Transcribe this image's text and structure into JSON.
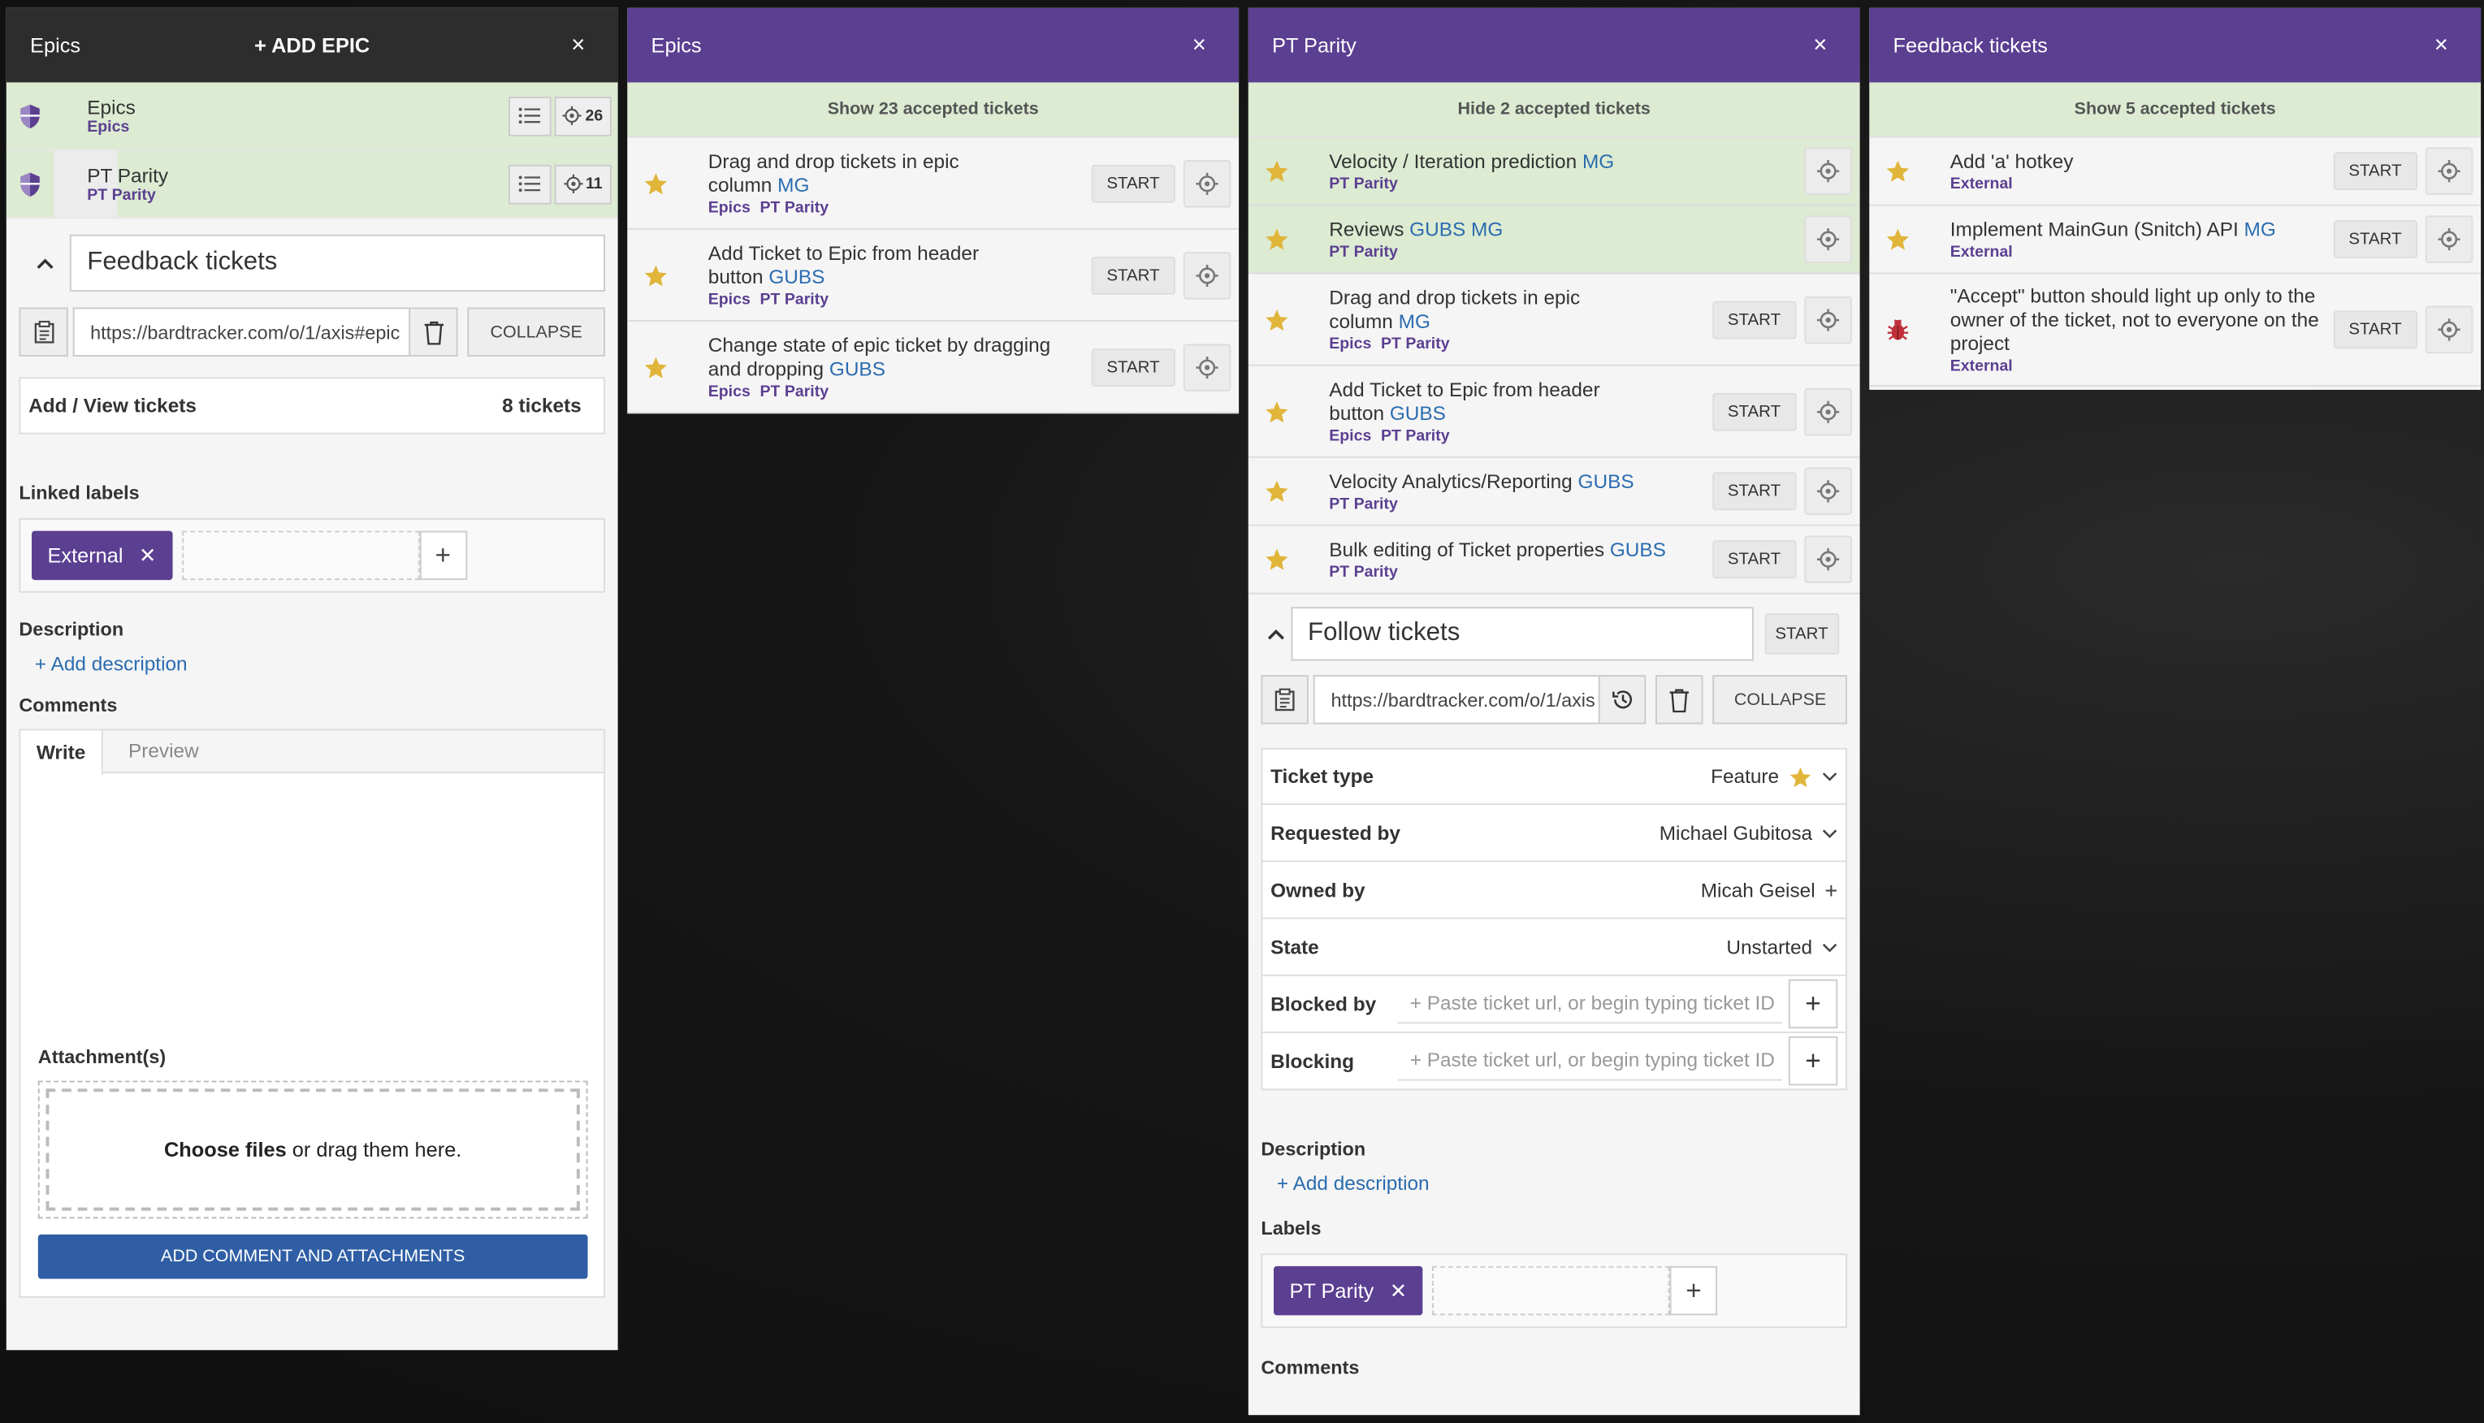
{
  "panel1": {
    "title": "Epics",
    "add_label": "+ ADD EPIC",
    "close": "×",
    "epics": [
      {
        "name": "Epics",
        "label": "Epics",
        "count": "26"
      },
      {
        "name": "PT Parity",
        "label": "PT Parity",
        "count": "11"
      }
    ],
    "editor": {
      "title_value": "Feedback tickets",
      "url": "https://bardtracker.com/o/1/axis#epic",
      "collapse": "COLLAPSE",
      "add_view": "Add / View tickets",
      "ticket_count": "8 tickets",
      "linked_labels": "Linked labels",
      "chip": "External",
      "description": "Description",
      "add_description": "+ Add description",
      "comments": "Comments",
      "tab_write": "Write",
      "tab_preview": "Preview",
      "attachments": "Attachment(s)",
      "choose_files": "Choose files",
      "drag_text": " or drag them here.",
      "submit": "ADD COMMENT AND ATTACHMENTS"
    }
  },
  "panel2": {
    "title": "Epics",
    "close": "×",
    "accepted": "Show 23 accepted tickets",
    "tickets": [
      {
        "line1": "Drag and drop tickets in epic",
        "line2": "column ",
        "owner": "MG",
        "labels": [
          "Epics",
          "PT Parity"
        ],
        "start": "START"
      },
      {
        "line1": "Add Ticket to Epic from header",
        "line2": "button ",
        "owner": "GUBS",
        "labels": [
          "Epics",
          "PT Parity"
        ],
        "start": "START"
      },
      {
        "line1": "Change state of epic ticket by dragging",
        "line2": "and dropping ",
        "owner": "GUBS",
        "labels": [
          "Epics",
          "PT Parity"
        ],
        "start": "START"
      }
    ]
  },
  "panel3": {
    "title": "PT Parity",
    "close": "×",
    "accepted": "Hide 2 accepted tickets",
    "accepted_tickets": [
      {
        "title": "Velocity / Iteration prediction ",
        "owner": "MG",
        "label": "PT Parity"
      },
      {
        "title": "Reviews ",
        "owner": "GUBS MG",
        "label": "PT Parity"
      }
    ],
    "tickets": [
      {
        "line1": "Drag and drop tickets in epic",
        "line2": "column ",
        "owner": "MG",
        "labels": [
          "Epics",
          "PT Parity"
        ],
        "start": "START"
      },
      {
        "line1": "Add Ticket to Epic from header",
        "line2": "button ",
        "owner": "GUBS",
        "labels": [
          "Epics",
          "PT Parity"
        ],
        "start": "START"
      },
      {
        "line1": "Velocity Analytics/Reporting ",
        "line2": "",
        "owner": "GUBS",
        "labels": [
          "PT Parity"
        ],
        "start": "START"
      },
      {
        "line1": "Bulk editing of Ticket properties ",
        "line2": "",
        "owner": "GUBS",
        "labels": [
          "PT Parity"
        ],
        "start": "START"
      }
    ],
    "detail": {
      "title_value": "Follow tickets",
      "start": "START",
      "url": "https://bardtracker.com/o/1/axis",
      "collapse": "COLLAPSE",
      "fields": {
        "ticket_type": {
          "label": "Ticket type",
          "value": "Feature"
        },
        "requested_by": {
          "label": "Requested by",
          "value": "Michael Gubitosa"
        },
        "owned_by": {
          "label": "Owned by",
          "value": "Micah Geisel"
        },
        "state": {
          "label": "State",
          "value": "Unstarted"
        },
        "blocked_by": {
          "label": "Blocked by",
          "placeholder": "+ Paste ticket url, or begin typing ticket ID"
        },
        "blocking": {
          "label": "Blocking",
          "placeholder": "+ Paste ticket url, or begin typing ticket ID"
        }
      },
      "description": "Description",
      "add_description": "+ Add description",
      "labels": "Labels",
      "chip": "PT Parity",
      "comments": "Comments"
    }
  },
  "panel4": {
    "title": "Feedback tickets",
    "close": "×",
    "accepted": "Show 5 accepted tickets",
    "tickets": [
      {
        "line1": "Add 'a' hotkey",
        "owner": "",
        "label": "External",
        "start": "START",
        "type": "feature"
      },
      {
        "line1": "Implement MainGun (Snitch) API ",
        "owner": "MG",
        "label": "External",
        "start": "START",
        "type": "feature"
      },
      {
        "line1": "\"Accept\" button should light up only to the owner of the ticket, not to everyone on the project",
        "owner": "",
        "label": "External",
        "start": "START",
        "type": "bug"
      }
    ]
  },
  "colors": {
    "purple": "#5b3f91",
    "accepted_green": "#dcebd2",
    "link_blue": "#2b6cb0",
    "star": "#e0b53a",
    "bug": "#c0303a"
  }
}
